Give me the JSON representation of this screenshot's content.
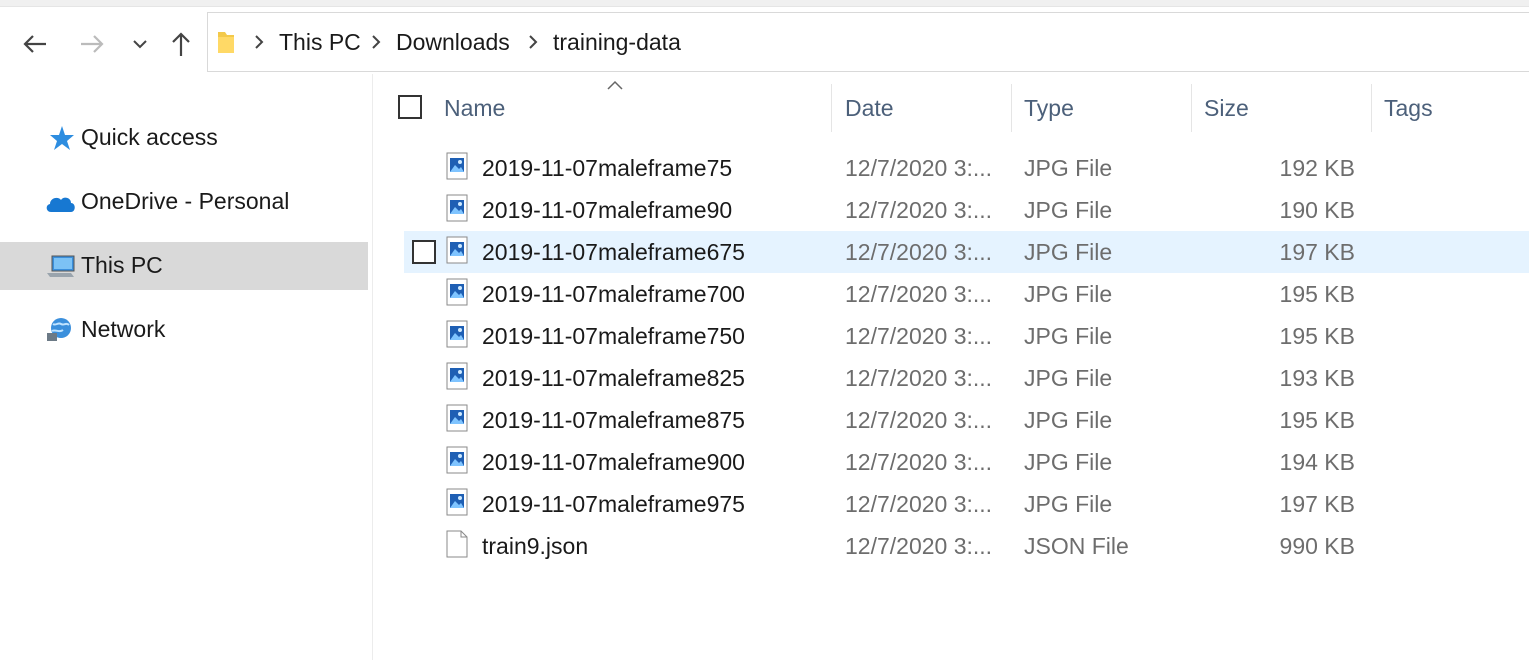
{
  "window": {
    "breadcrumb": [
      "This PC",
      "Downloads",
      "training-data"
    ]
  },
  "nav": {
    "back_icon": "arrow-left-icon",
    "forward_icon": "arrow-right-icon",
    "recent_icon": "chevron-down-icon",
    "up_icon": "arrow-up-icon"
  },
  "sidebar": {
    "items": [
      {
        "label": "Quick access",
        "icon": "star-icon"
      },
      {
        "label": "OneDrive - Personal",
        "icon": "cloud-icon"
      },
      {
        "label": "This PC",
        "icon": "computer-icon",
        "selected": true
      },
      {
        "label": "Network",
        "icon": "network-icon"
      }
    ]
  },
  "columns": {
    "name": "Name",
    "date": "Date",
    "type": "Type",
    "size": "Size",
    "tags": "Tags"
  },
  "files": [
    {
      "name": "2019-11-07maleframe75",
      "date": "12/7/2020 3:...",
      "type": "JPG File",
      "size": "192 KB",
      "icon": "image-file-icon"
    },
    {
      "name": "2019-11-07maleframe90",
      "date": "12/7/2020 3:...",
      "type": "JPG File",
      "size": "190 KB",
      "icon": "image-file-icon"
    },
    {
      "name": "2019-11-07maleframe675",
      "date": "12/7/2020 3:...",
      "type": "JPG File",
      "size": "197 KB",
      "icon": "image-file-icon",
      "hovered": true
    },
    {
      "name": "2019-11-07maleframe700",
      "date": "12/7/2020 3:...",
      "type": "JPG File",
      "size": "195 KB",
      "icon": "image-file-icon"
    },
    {
      "name": "2019-11-07maleframe750",
      "date": "12/7/2020 3:...",
      "type": "JPG File",
      "size": "195 KB",
      "icon": "image-file-icon"
    },
    {
      "name": "2019-11-07maleframe825",
      "date": "12/7/2020 3:...",
      "type": "JPG File",
      "size": "193 KB",
      "icon": "image-file-icon"
    },
    {
      "name": "2019-11-07maleframe875",
      "date": "12/7/2020 3:...",
      "type": "JPG File",
      "size": "195 KB",
      "icon": "image-file-icon"
    },
    {
      "name": "2019-11-07maleframe900",
      "date": "12/7/2020 3:...",
      "type": "JPG File",
      "size": "194 KB",
      "icon": "image-file-icon"
    },
    {
      "name": "2019-11-07maleframe975",
      "date": "12/7/2020 3:...",
      "type": "JPG File",
      "size": "197 KB",
      "icon": "image-file-icon"
    },
    {
      "name": "train9.json",
      "date": "12/7/2020 3:...",
      "type": "JSON File",
      "size": "990 KB",
      "icon": "generic-file-icon"
    }
  ],
  "colors": {
    "selected_bg": "#d9d9d9",
    "hover_bg": "#e5f3ff",
    "header_text": "#4c607a",
    "secondary_text": "#6d6d6d"
  }
}
